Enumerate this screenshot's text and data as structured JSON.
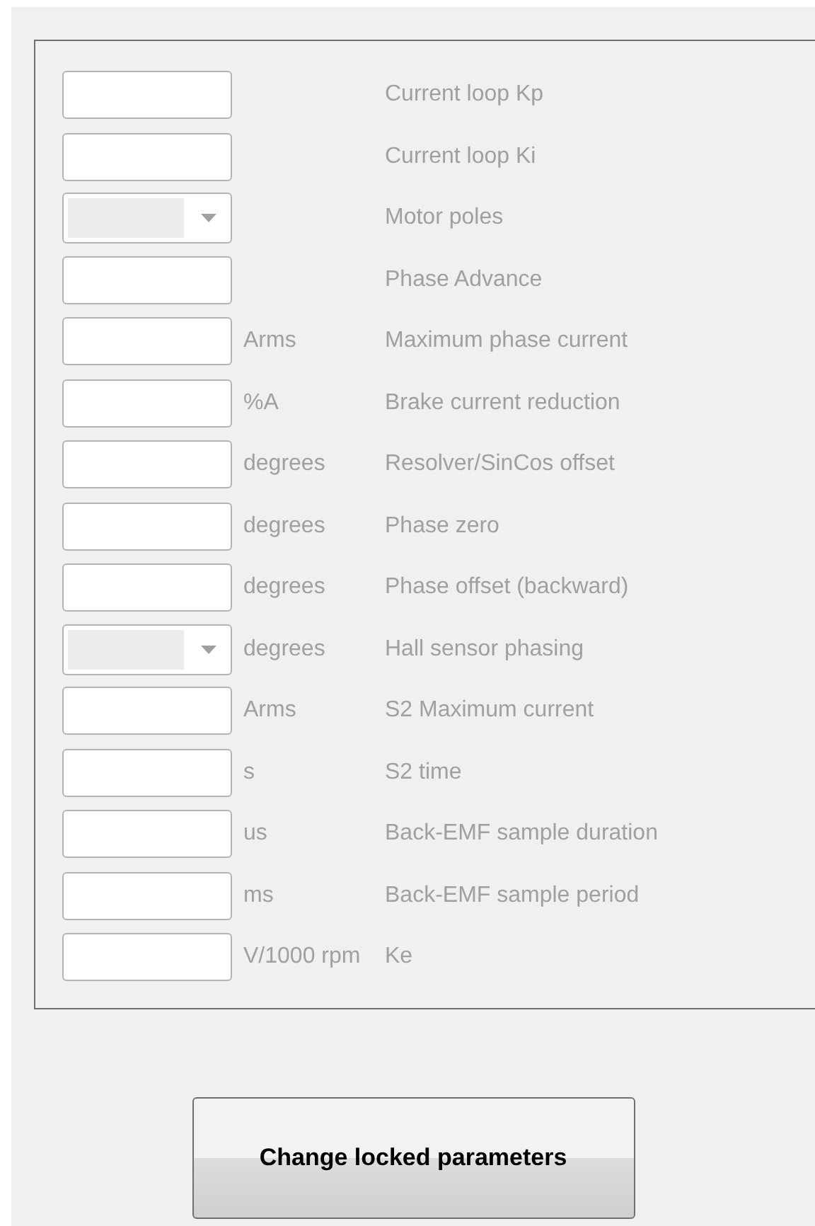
{
  "rows": [
    {
      "kind": "text",
      "label": "Current loop Kp"
    },
    {
      "kind": "text",
      "label": "Current loop Ki"
    },
    {
      "kind": "dropdown",
      "label": "Motor poles"
    },
    {
      "kind": "text",
      "label": "Phase Advance"
    },
    {
      "kind": "text",
      "unit": "Arms",
      "label": "Maximum phase current"
    },
    {
      "kind": "text",
      "unit": "%A",
      "label": "Brake current reduction"
    },
    {
      "kind": "text",
      "unit": "degrees",
      "label": "Resolver/SinCos offset"
    },
    {
      "kind": "text",
      "unit": "degrees",
      "label": "Phase zero"
    },
    {
      "kind": "text",
      "unit": "degrees",
      "label": "Phase offset (backward)"
    },
    {
      "kind": "dropdown",
      "unit": "degrees",
      "label": "Hall sensor phasing"
    },
    {
      "kind": "text",
      "unit": "Arms",
      "label": "S2 Maximum current"
    },
    {
      "kind": "text",
      "unit": "s",
      "label": "S2 time"
    },
    {
      "kind": "text",
      "unit": "us",
      "label": "Back-EMF sample duration"
    },
    {
      "kind": "text",
      "unit": "ms",
      "label": "Back-EMF sample period"
    },
    {
      "kind": "text",
      "unit": "V/1000 rpm",
      "label": "Ke"
    }
  ],
  "button": "Change locked parameters"
}
